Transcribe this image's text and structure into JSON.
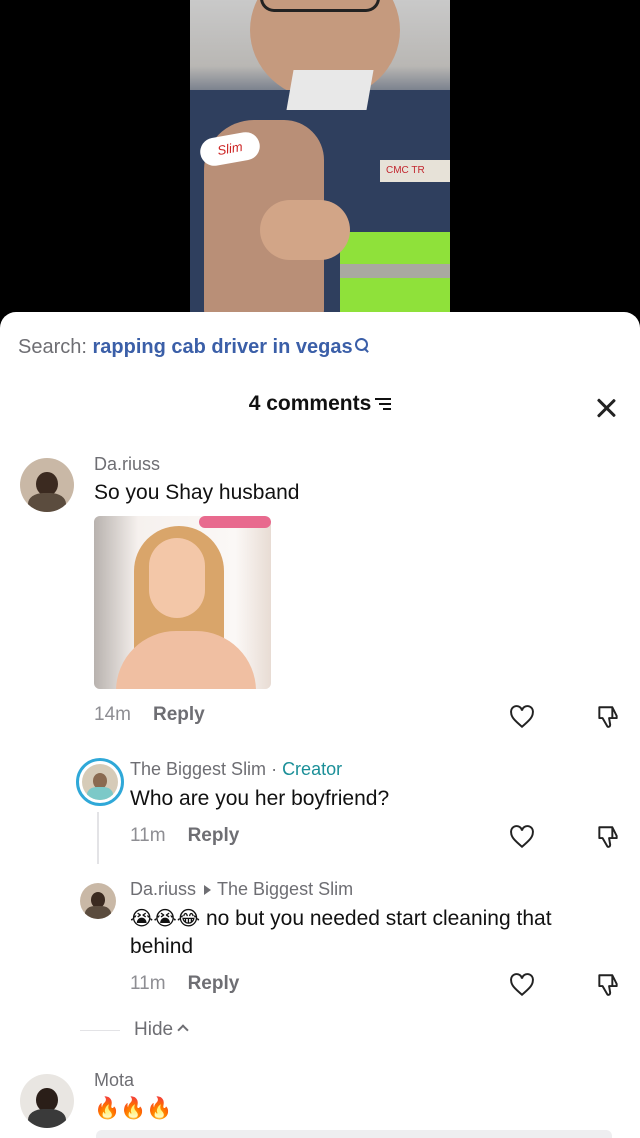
{
  "video": {
    "patch_text": "Slim",
    "logo_text": "CMC TR"
  },
  "search": {
    "label": "Search: ",
    "query": "rapping cab driver in vegas"
  },
  "header": {
    "title": "4 comments"
  },
  "comments": [
    {
      "username": "Da.riuss",
      "text": "So you Shay husband",
      "time": "14m",
      "reply_label": "Reply",
      "has_gif": true
    },
    {
      "username": "The Biggest Slim",
      "separator": " · ",
      "creator_label": "Creator",
      "text": "Who are you her boyfriend?",
      "time": "11m",
      "reply_label": "Reply"
    },
    {
      "username": "Da.riuss",
      "reply_to": "The Biggest Slim",
      "emojis": "😭😭😂",
      "text": " no but you needed start cleaning that behind",
      "time": "11m",
      "reply_label": "Reply"
    },
    {
      "username": "Mota",
      "text": "🔥🔥🔥"
    }
  ],
  "hide_label": "Hide",
  "colors": {
    "search_query": "#3b5fa8",
    "creator": "#1b8f98",
    "avatar_ring": "#2fa8d8"
  }
}
